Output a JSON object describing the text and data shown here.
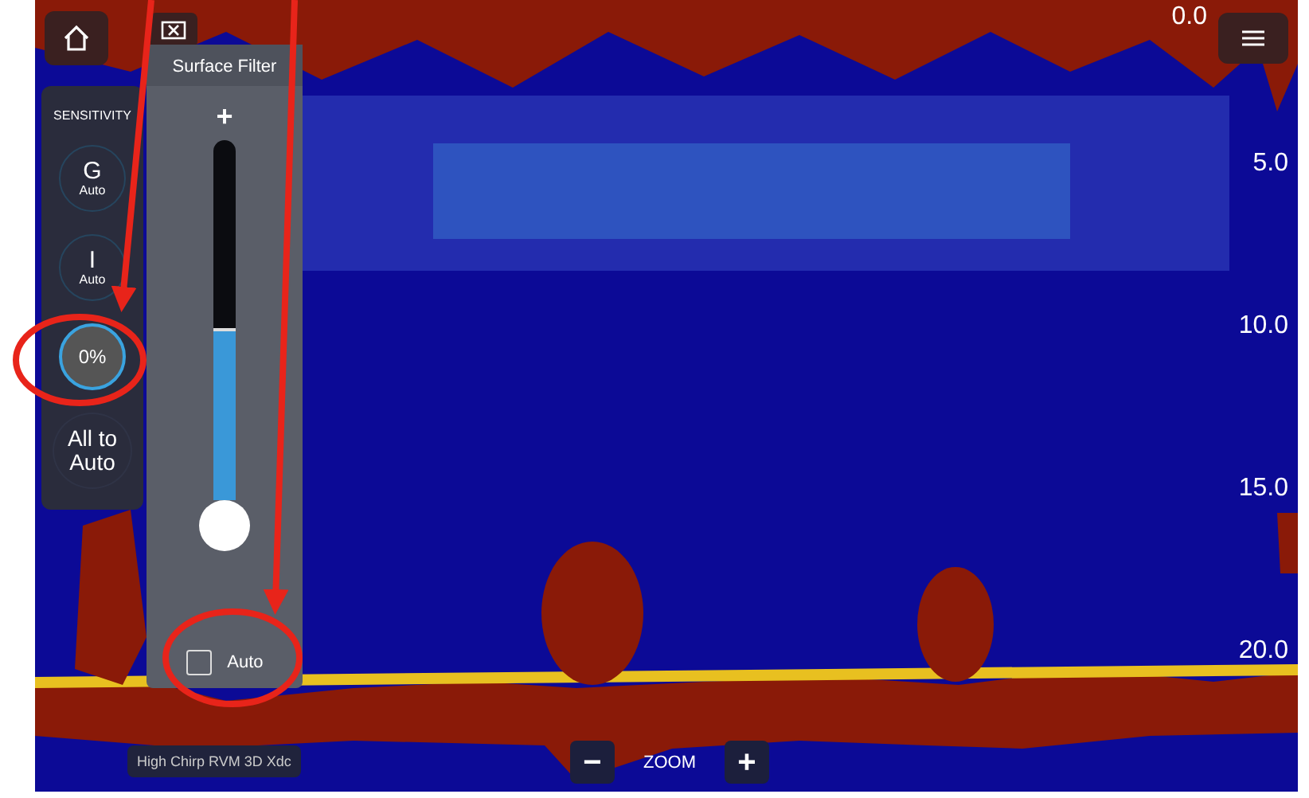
{
  "sensitivity": {
    "title": "SENSITIVITY",
    "items": [
      {
        "kind": "letter",
        "label": "G",
        "sub": "Auto",
        "selected": false
      },
      {
        "kind": "letter",
        "label": "I",
        "sub": "Auto",
        "selected": false
      },
      {
        "kind": "value",
        "label": "0%",
        "selected": true
      },
      {
        "kind": "text",
        "label": "All to Auto",
        "selected": false
      }
    ]
  },
  "surface_filter": {
    "title": "Surface Filter",
    "plus": "+",
    "level": 0.47,
    "auto_label": "Auto",
    "auto_checked": false
  },
  "depth_scale": [
    "0.0",
    "5.0",
    "10.0",
    "15.0",
    "20.0"
  ],
  "transducer": "High Chirp RVM 3D Xdc",
  "zoom": {
    "minus": "−",
    "label": "ZOOM",
    "plus": "+"
  }
}
